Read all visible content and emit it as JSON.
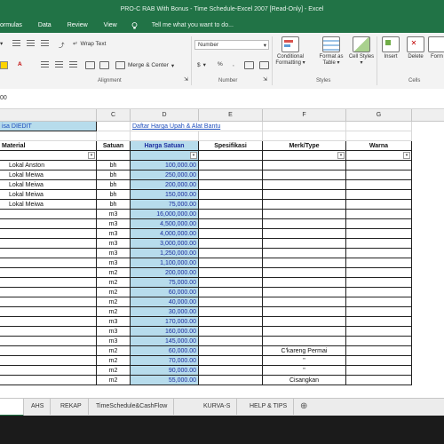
{
  "window": {
    "title": "PRO-C RAB With Bonus - Time Schedule-Excel 2007  [Read-Only] - Excel"
  },
  "menu": {
    "items": [
      "ormulas",
      "Data",
      "Review",
      "View"
    ],
    "tell_me": "Tell me what you want to do..."
  },
  "ribbon": {
    "wrap_text": "Wrap Text",
    "merge_center": "Merge & Center",
    "number_format": "Number",
    "currency": "$",
    "percent": "%",
    "comma": ",",
    "conditional_formatting": "Conditional Formatting",
    "format_as_table": "Format as Table",
    "cell_styles": "Cell Styles",
    "insert": "Insert",
    "delete": "Delete",
    "format": "Form",
    "group_alignment": "Alignment",
    "group_number": "Number",
    "group_styles": "Styles",
    "group_cells": "Cells"
  },
  "formula_bar": {
    "cell_ref": "00"
  },
  "columns": {
    "c": "C",
    "d": "D",
    "e": "E",
    "f": "F",
    "g": "G"
  },
  "sheet": {
    "row1": {
      "a": "isa DIEDIT",
      "d": "Daftar Harga Upah & Alat Bantu"
    },
    "headers": {
      "a": "Material",
      "c": "Satuan",
      "d": "Harga Satuan",
      "e": "Spesifikasi",
      "f": "Merk/Type",
      "g": "Warna"
    },
    "filter_glyph": "▾",
    "rows": [
      {
        "a": "Lokal Anston",
        "c": "bh",
        "d": "100,000.00",
        "f": ""
      },
      {
        "a": "Lokal Meiwa",
        "c": "bh",
        "d": "250,000.00",
        "f": ""
      },
      {
        "a": "Lokal Meiwa",
        "c": "bh",
        "d": "200,000.00",
        "f": ""
      },
      {
        "a": "Lokal Meiwa",
        "c": "bh",
        "d": "150,000.00",
        "f": ""
      },
      {
        "a": "Lokal Meiwa",
        "c": "bh",
        "d": "75,000.00",
        "f": ""
      },
      {
        "a": "",
        "c": "m3",
        "d": "16,000,000.00",
        "f": ""
      },
      {
        "a": "",
        "c": "m3",
        "d": "4,500,000.00",
        "f": ""
      },
      {
        "a": "",
        "c": "m3",
        "d": "4,000,000.00",
        "f": ""
      },
      {
        "a": "",
        "c": "m3",
        "d": "3,000,000.00",
        "f": ""
      },
      {
        "a": "",
        "c": "m3",
        "d": "1,250,000.00",
        "f": ""
      },
      {
        "a": "",
        "c": "m3",
        "d": "1,100,000.00",
        "f": ""
      },
      {
        "a": "",
        "c": "m2",
        "d": "200,000.00",
        "f": ""
      },
      {
        "a": "",
        "c": "m2",
        "d": "75,000.00",
        "f": ""
      },
      {
        "a": "",
        "c": "m2",
        "d": "60,000.00",
        "f": ""
      },
      {
        "a": "",
        "c": "m2",
        "d": "40,000.00",
        "f": ""
      },
      {
        "a": "",
        "c": "m2",
        "d": "30,000.00",
        "f": ""
      },
      {
        "a": "",
        "c": "m3",
        "d": "170,000.00",
        "f": ""
      },
      {
        "a": "",
        "c": "m3",
        "d": "160,000.00",
        "f": ""
      },
      {
        "a": "",
        "c": "m3",
        "d": "145,000.00",
        "f": ""
      },
      {
        "a": "",
        "c": "m2",
        "d": "60,000.00",
        "f": "C'kareng Permai"
      },
      {
        "a": "",
        "c": "m2",
        "d": "70,000.00",
        "f": "\""
      },
      {
        "a": "",
        "c": "m2",
        "d": "90,000.00",
        "f": "\""
      },
      {
        "a": "",
        "c": "m2",
        "d": "55,000.00",
        "f": "Cisangkan"
      }
    ]
  },
  "tabs": {
    "items": [
      "AHS",
      "REKAP",
      "TimeSchedule&CashFlow",
      "KURVA-S",
      "HELP & TIPS"
    ],
    "add": "⊕"
  },
  "colors": {
    "excel_green": "#217346",
    "header_fill": "#b7dcec",
    "link": "#1f4fbd",
    "value_text": "#1d2fa0"
  }
}
